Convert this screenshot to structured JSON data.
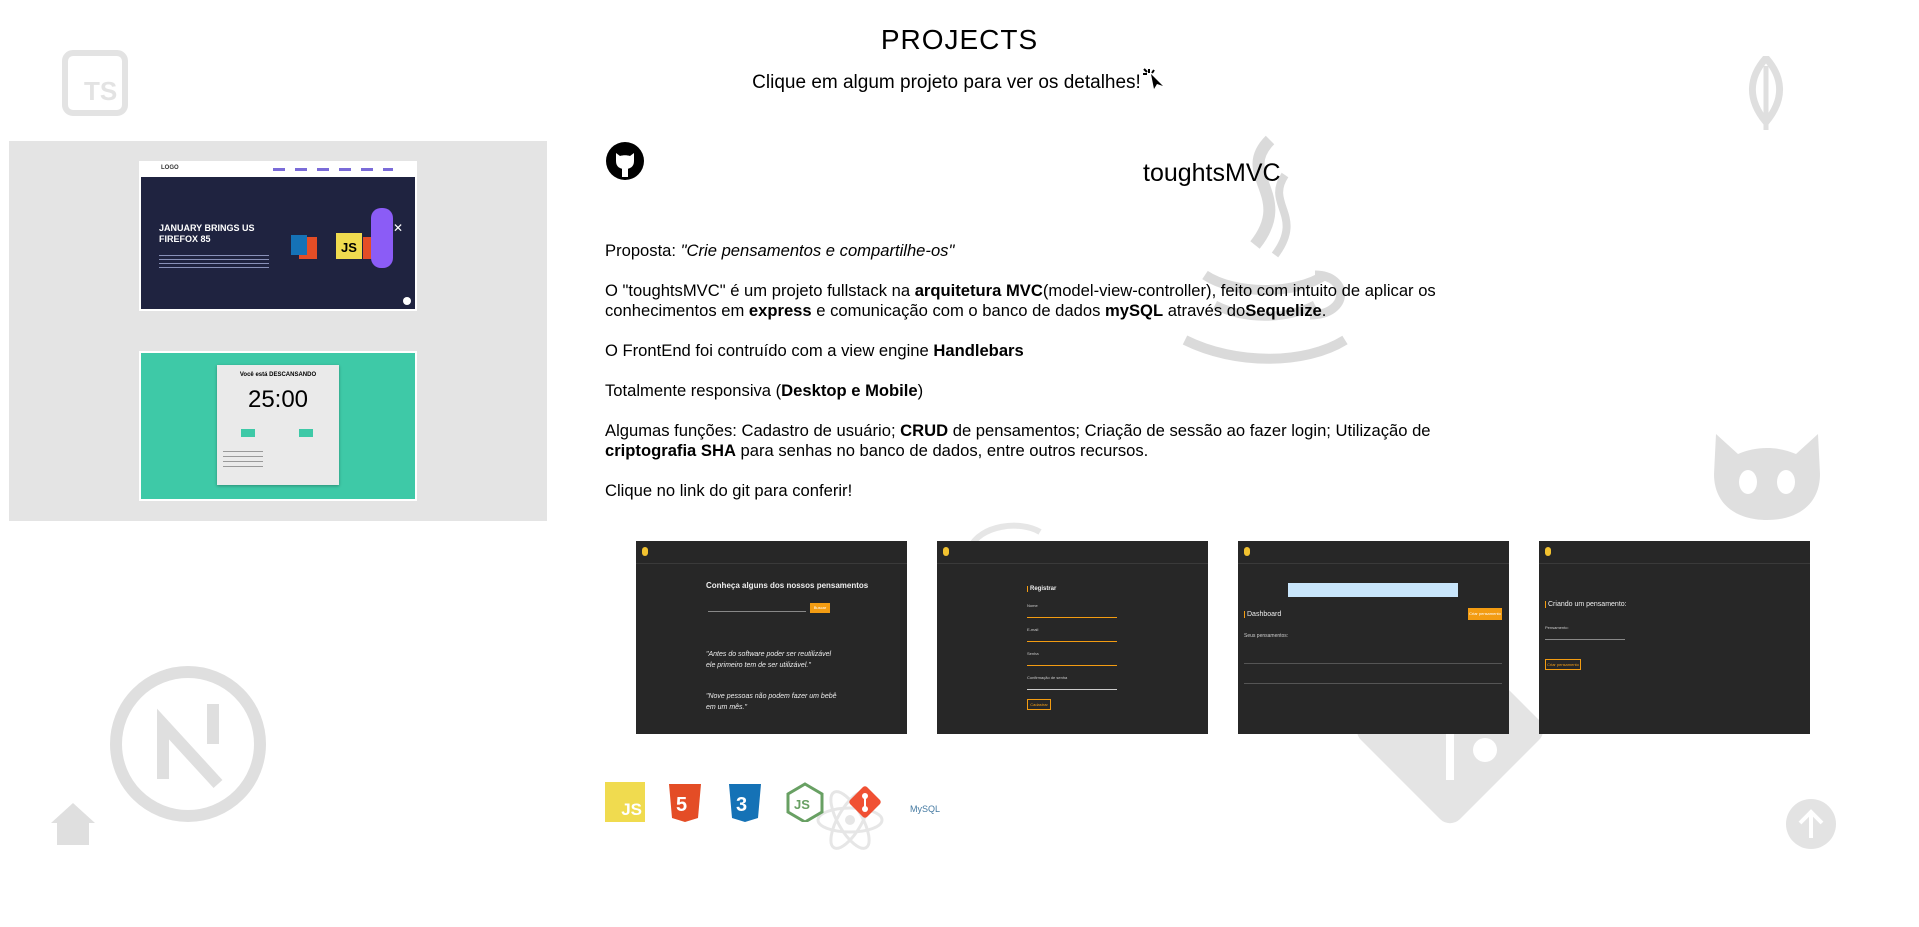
{
  "header": {
    "title": "PROJECTS",
    "subtitle": "Clique em algum projeto para ver os detalhes!"
  },
  "background_icons": [
    "typescript-icon",
    "mongodb-leaf-icon",
    "github-octocat-icon",
    "java-icon",
    "next-icon",
    "git-icon",
    "home-icon",
    "scroll-top-icon"
  ],
  "projects": [
    {
      "thumb_title": "JANUARY BRINGS US FIREFOX 85",
      "thumb_logo": "LOGO",
      "badges": [
        "JS"
      ]
    },
    {
      "thumb_title": "Você está DESCANSANDO",
      "thumb_timer": "25:00"
    }
  ],
  "detail": {
    "name": "toughtsMVC",
    "proposal_label": "Proposta: ",
    "proposal_quote": "\"Crie pensamentos e compartilhe-os\"",
    "p1_a": "O \"toughtsMVC\" é um projeto fullstack na ",
    "p1_b": "arquitetura MVC",
    "p1_c": "(model-view-controller), feito com intuito de aplicar os conhecimentos em ",
    "p1_d": "express",
    "p1_e": " e comunicação com o banco de dados ",
    "p1_f": "mySQL",
    "p1_g": " através do",
    "p1_h": "Sequelize",
    "p1_i": ".",
    "p2_a": "O FrontEnd foi contruído com a view engine ",
    "p2_b": "Handlebars",
    "p3_a": "Totalmente responsiva (",
    "p3_b": "Desktop e Mobile",
    "p3_c": ")",
    "p4_a": "Algumas funções: Cadastro de usuário; ",
    "p4_b": "CRUD",
    "p4_c": " de pensamentos; Criação de sessão ao fazer login; Utilização de ",
    "p4_d": "criptografia SHA",
    "p4_e": " para senhas no banco de dados, entre outros recursos.",
    "p5": "Clique no link do git para conferir!"
  },
  "screenshots": [
    {
      "heading": "Conheça alguns dos nossos pensamentos",
      "button": "Buscar",
      "quote1": "\"Antes do software poder ser reutilizável ele primeiro tem de ser utilizável.\"",
      "quote2": "\"Nove pessoas não podem fazer um bebê em um mês.\""
    },
    {
      "heading": "Registrar",
      "field1": "Nome",
      "field2": "E-mail",
      "field3": "Senha",
      "field4": "Confirmação de senha",
      "button": "Cadastrar"
    },
    {
      "heading": "Dashboard",
      "button": "Criar pensamento",
      "subheading": "Seus pensamentos:"
    },
    {
      "heading": "Criando um pensamento:",
      "field1": "Pensamento:",
      "button": "Criar pensamento"
    }
  ],
  "technologies": [
    "JS",
    "HTML5",
    "CSS3",
    "Node.js",
    "Git",
    "MySQL"
  ],
  "colors": {
    "sidebar_bg": "#e4e4e4",
    "accent": "#f39c12",
    "bg_icon": "#dcdcdc"
  }
}
